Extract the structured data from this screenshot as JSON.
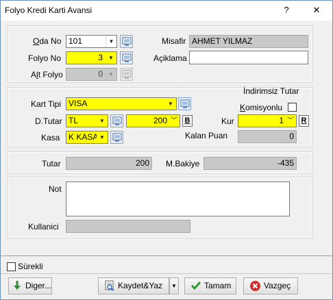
{
  "window": {
    "title": "Folyo Kredi Karti Avansi",
    "help": "?",
    "close": "✕"
  },
  "top": {
    "oda_no_label": "Oda No",
    "oda_no_value": "101",
    "folyo_no_label": "Folyo No",
    "folyo_no_value": "3",
    "alt_folyo_label": "Alt Folyo",
    "alt_folyo_value": "0",
    "misafir_label": "Misafir",
    "misafir_value": "AHMET YILMAZ",
    "aciklama_label": "Açiklama",
    "aciklama_value": ""
  },
  "card": {
    "indirimsiz_label": "İndirimsiz Tutar",
    "komisyonlu_label": "Komisyonlu",
    "komisyonlu_checked": false,
    "kart_tipi_label": "Kart Tipi",
    "kart_tipi_value": "VISA",
    "dtutar_label": "D.Tutar",
    "dtutar_currency": "TL",
    "dtutar_amount": "200",
    "b_button": "B",
    "kur_label": "Kur",
    "kur_value": "1",
    "r_button": "R",
    "kasa_label": "Kasa",
    "kasa_value": "K KASA",
    "kalan_puan_label": "Kalan Puan",
    "kalan_puan_value": "0"
  },
  "totals": {
    "tutar_label": "Tutar",
    "tutar_value": "200",
    "mbakiye_label": "M.Bakiye",
    "mbakiye_value": "-435"
  },
  "notes": {
    "not_label": "Not",
    "not_value": "",
    "kullanici_label": "Kullanici",
    "kullanici_value": ""
  },
  "footer": {
    "surekli_label": "Sürekli",
    "surekli_checked": false,
    "diger_label": "Diger...",
    "kaydet_label": "Kaydet&Yaz",
    "tamam_label": "Tamam",
    "vazgec_label": "Vazgeç"
  },
  "colors": {
    "required": "#ffff00",
    "readonly": "#c8c8c8",
    "window_bg": "#f0f0f0"
  }
}
